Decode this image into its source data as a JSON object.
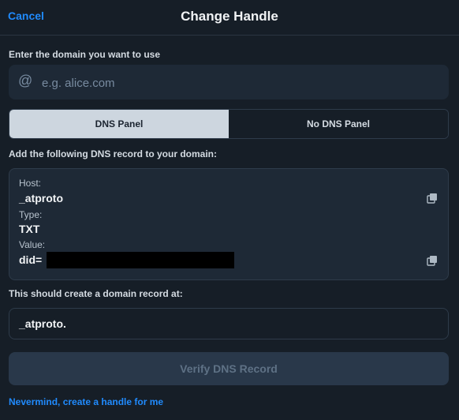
{
  "header": {
    "cancel_label": "Cancel",
    "title": "Change Handle"
  },
  "domain_input": {
    "label": "Enter the domain you want to use",
    "icon": "at-sign-icon",
    "placeholder": "e.g. alice.com",
    "value": ""
  },
  "tabs": [
    {
      "label": "DNS Panel",
      "active": true
    },
    {
      "label": "No DNS Panel",
      "active": false
    }
  ],
  "dns_record": {
    "instruction": "Add the following DNS record to your domain:",
    "host_label": "Host:",
    "host_value": "_atproto",
    "type_label": "Type:",
    "type_value": "TXT",
    "value_label": "Value:",
    "value_value": "did=",
    "copy_icon": "copy-icon"
  },
  "domain_record": {
    "label": "This should create a domain record at:",
    "value": "_atproto."
  },
  "verify_button_label": "Verify DNS Record",
  "nevermind_link": "Nevermind, create a handle for me",
  "colors": {
    "background": "#161e27",
    "accent": "#208bfe",
    "active_tab_bg": "#cdd6df",
    "field_bg": "#1e2936",
    "disabled_button_bg": "#29384a"
  }
}
